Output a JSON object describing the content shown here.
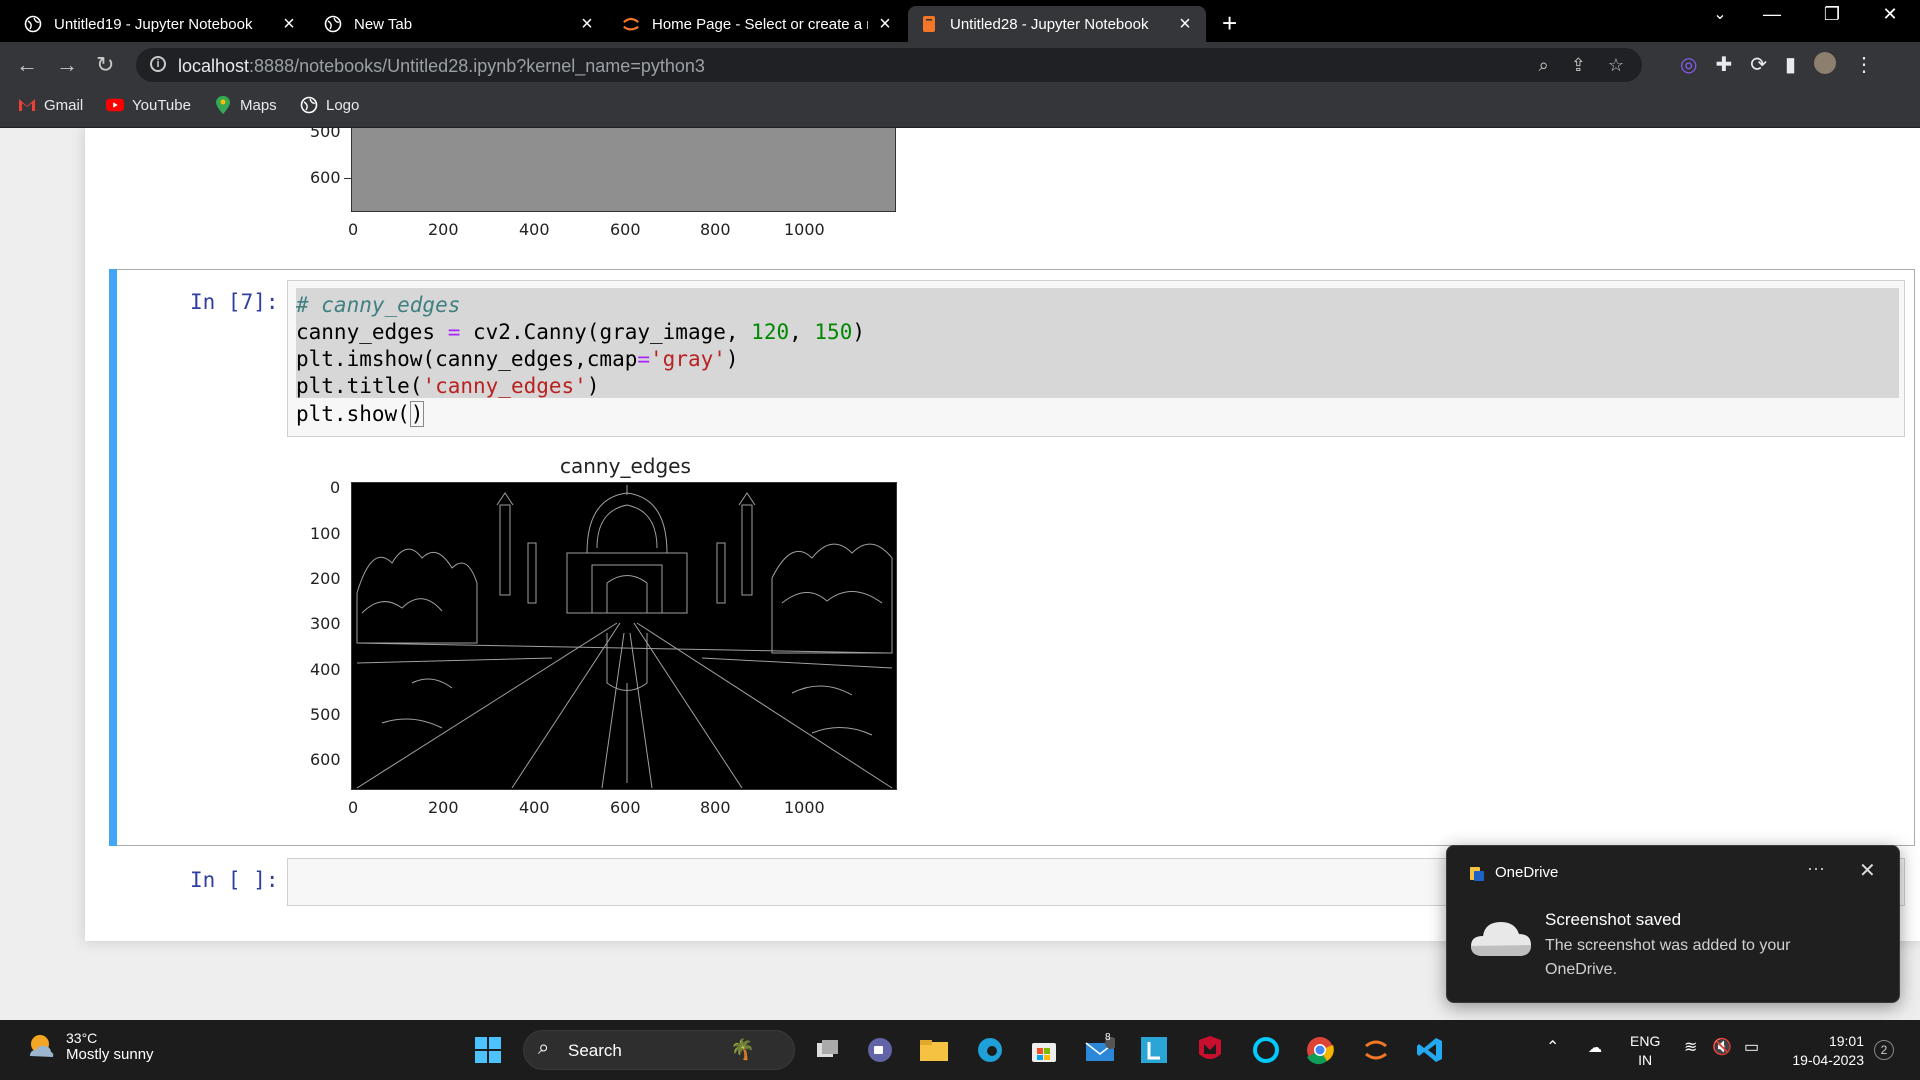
{
  "browser": {
    "tabs": [
      {
        "title": "Untitled19 - Jupyter Notebook",
        "active": false
      },
      {
        "title": "New Tab",
        "active": false
      },
      {
        "title": "Home Page - Select or create a n",
        "active": false
      },
      {
        "title": "Untitled28 - Jupyter Notebook",
        "active": true
      }
    ],
    "url_host": "localhost",
    "url_rest": ":8888/notebooks/Untitled28.ipynb?kernel_name=python3",
    "bookmarks": [
      "Gmail",
      "YouTube",
      "Maps",
      "Logo"
    ]
  },
  "notebook": {
    "top_plot": {
      "y_ticks": [
        "500",
        "600"
      ],
      "x_ticks": [
        "0",
        "200",
        "400",
        "600",
        "800",
        "1000"
      ]
    },
    "cell7": {
      "prompt": "In [7]:",
      "line1_comment": "# canny_edges",
      "line2_a": "canny_edges ",
      "line2_op": "=",
      "line2_b": " cv2.Canny(gray_image, ",
      "line2_n1": "120",
      "line2_c": ", ",
      "line2_n2": "150",
      "line2_d": ")",
      "line3_a": "plt.imshow(canny_edges,cmap",
      "line3_op": "=",
      "line3_s": "'gray'",
      "line3_b": ")",
      "line4_a": "plt.title(",
      "line4_s": "'canny_edges'",
      "line4_b": ")",
      "line5_a": "plt.show(",
      "line5_b": ")"
    },
    "output_plot": {
      "title": "canny_edges",
      "y_ticks": [
        "0",
        "100",
        "200",
        "300",
        "400",
        "500",
        "600"
      ],
      "x_ticks": [
        "0",
        "200",
        "400",
        "600",
        "800",
        "1000"
      ]
    },
    "empty_cell_prompt": "In [ ]:"
  },
  "toast": {
    "app": "OneDrive",
    "title": "Screenshot saved",
    "body": "The screenshot was added to your OneDrive."
  },
  "taskbar": {
    "temp": "33°C",
    "weather": "Mostly sunny",
    "search": "Search",
    "lang1": "ENG",
    "lang2": "IN",
    "time": "19:01",
    "date": "19-04-2023",
    "notif_count": "2",
    "mail_badge": "8"
  }
}
